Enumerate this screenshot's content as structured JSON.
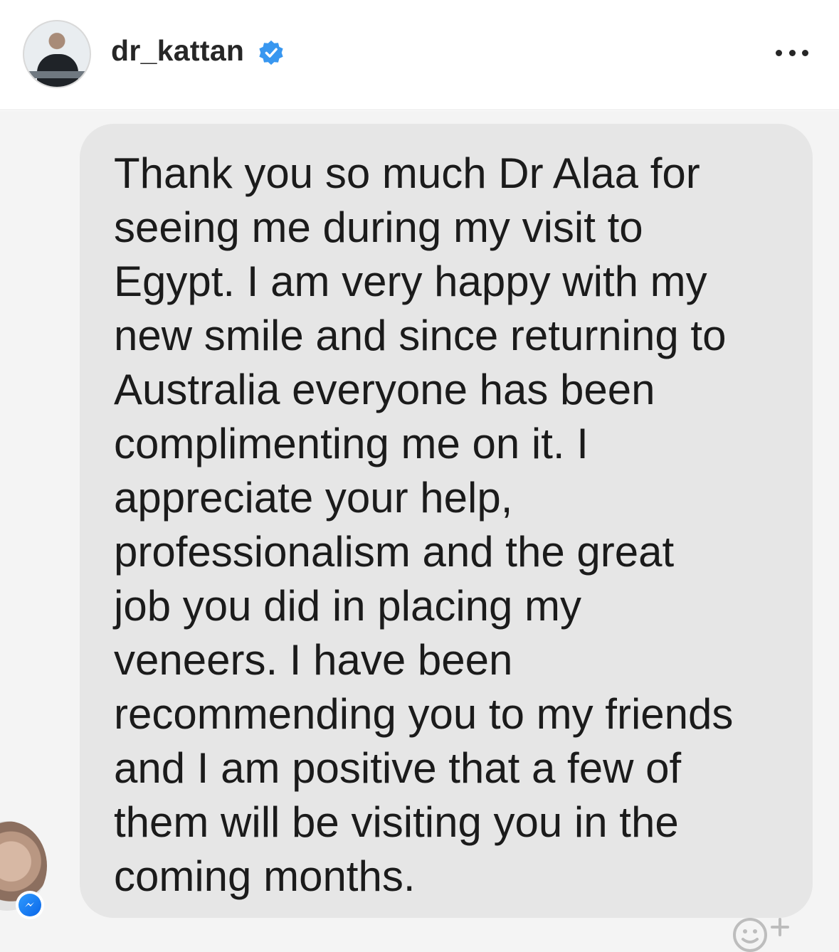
{
  "header": {
    "username": "dr_kattan",
    "verified": true,
    "more_icon": "more-horizontal-icon"
  },
  "message": {
    "lines": [
      "Thank you so much Dr Alaa for",
      "seeing me during my visit to",
      "Egypt. I am very happy with my",
      "new smile and since returning to",
      "Australia everyone has been",
      "complimenting me on it. I",
      "appreciate your help,",
      "professionalism and the great",
      "job you did in placing my",
      "veneers. I have been",
      "recommending you to my friends",
      "and I am positive that a few of",
      "them will be visiting you in the",
      "coming months."
    ]
  },
  "colors": {
    "verified_blue": "#3897f0",
    "bubble_gray": "#e6e6e6",
    "background": "#f4f4f4",
    "messenger_blue": "#0a7cff"
  },
  "icons": {
    "sender_badge": "messenger-icon",
    "reaction": "add-reaction-icon"
  }
}
